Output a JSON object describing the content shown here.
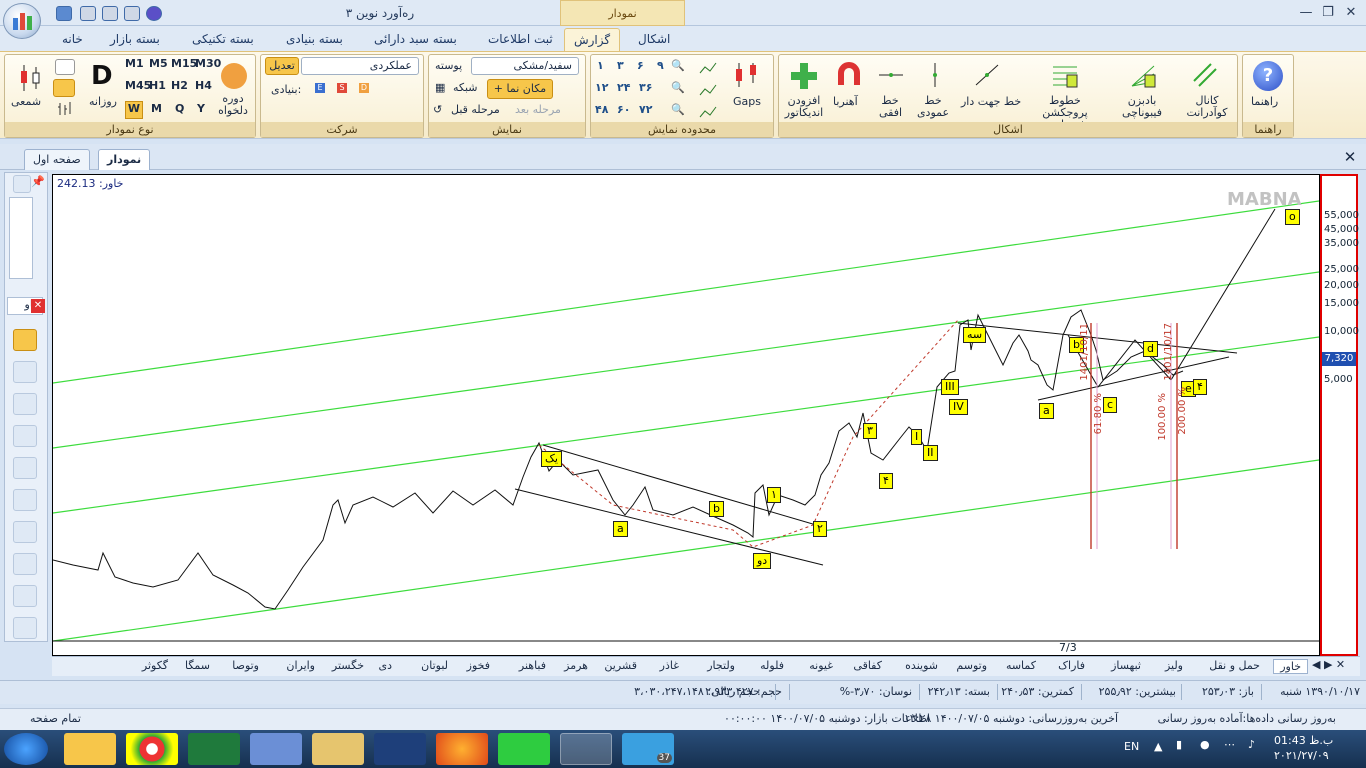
{
  "window": {
    "title": "ره‌آورد نوین ۳",
    "context_tab": "نمودار",
    "controls": [
      "—",
      "❐",
      "✕"
    ]
  },
  "ribbon_tabs": [
    "خانه",
    "بسته بازار",
    "بسته تکنیکی",
    "بسته بنیادی",
    "بسته سبد دارائی",
    "ثبت اطلاعات",
    "گزارش",
    "اشکال"
  ],
  "groups": {
    "chart_type": {
      "title": "نوع نمودار",
      "candle_label": "شمعی",
      "daily_label": "روزانه",
      "daily_letter": "D",
      "period_label": "دوره دلخواه",
      "timeframes": [
        "M1",
        "M5",
        "M15",
        "M30",
        "M45",
        "H1",
        "H2",
        "H4"
      ],
      "periods": [
        "W",
        "M",
        "Q",
        "Y"
      ]
    },
    "company": {
      "title": "شرکت",
      "adjust_button": "تعدیل",
      "adjust_mode": "عملکردی",
      "fundamental_label": "بنیادی:",
      "badges": [
        "E",
        "S",
        "D"
      ]
    },
    "display": {
      "title": "نمایش",
      "theme_label": "پوسته",
      "theme_value": "سفید/مشکی",
      "grid_label": "شبکه",
      "cursor_label": "مکان نما",
      "prev_step": "مرحله قبل",
      "next_step": "مرحله بعد"
    },
    "range": {
      "title": "محدوده نمایش",
      "ranges": [
        "۱",
        "۳",
        "۶",
        "۹",
        "۱۲",
        "۲۴",
        "۳۶",
        "۴۸",
        "۶۰",
        "۷۲"
      ],
      "gaps_label": "Gaps"
    },
    "shapes": {
      "title": "اشکال",
      "items": [
        "افزودن اندیکاتور",
        "آهنربا",
        "خط افقی",
        "خط عمودی",
        "خط جهت دار",
        "خطوط پروجکشن فیبوناچی",
        "بادبزن فیبوناچی",
        "کانال کوآدرانت"
      ]
    },
    "help": {
      "title": "راهنما",
      "label": "راهنما"
    }
  },
  "doc_tabs": [
    "صفحه اول",
    "نمودار"
  ],
  "left_tool_input": "خاو",
  "chart": {
    "header": "خاور: 242.13",
    "watermark": "MABNA",
    "date_label": "7/3",
    "price_box": "7,320",
    "y_ticks": [
      "55,000",
      "45,000",
      "35,000",
      "25,000",
      "20,000",
      "15,000",
      "10,000",
      "5,000"
    ],
    "wave_labels": [
      "یک",
      "دو",
      "سه",
      "a",
      "b",
      "c",
      "d",
      "e",
      "۱",
      "۲",
      "۳",
      "۴",
      "I",
      "II",
      "III",
      "IV",
      "a",
      "b",
      "۴",
      "o"
    ],
    "fib_labels": [
      "1401/10/11",
      "1401/10/17",
      "61.80 %",
      "100.00 %",
      "200.00 %"
    ]
  },
  "symbol_tabs": [
    "خاور",
    "حمل و نقل",
    "ولیز",
    "ثبهساز",
    "فاراک",
    "کماسه",
    "وتوسم",
    "شوینده",
    "کفاقی",
    "غیونه",
    "فلوله",
    "ولتجار",
    "غاذر",
    "قشرین",
    "هرمز",
    "فباهنر",
    "فخوز",
    "لبوتان",
    "دی",
    "خگستر",
    "وایران",
    "وتوصا",
    "سمگا",
    "گکوثر"
  ],
  "status": {
    "date": "۱۳۹۰/۱۰/۱۷ شنبه",
    "open": "باز: ۲۵۳٫۰۳",
    "high": "بیشترین: ۲۵۵٫۹۲",
    "low": "کمترین: ۲۴۰٫۵۳",
    "close": "بسته: ۲۴۲٫۱۳",
    "change": "نوسان: ۳٫۷۰-%",
    "volume": "حجم: ۲،۹۳۳،۴۲۷",
    "value": "حجم ریالی: ۳،۰۳۰،۲۴۷،۱۴۸",
    "sync_status": "به‌روز رسانی داده‌ها:آماده به‌روز رسانی",
    "last_update": "آخرین به‌روزرسانی: دوشنبه ۱۴۰۰/۰۷/۰۵ ۱۳:۲۸",
    "market_info": "اطلاعات بازار: دوشنبه ۱۴۰۰/۰۷/۰۵ ۰۰:۰۰:۰۰",
    "fullscreen": "تمام صفحه"
  },
  "taskbar": {
    "time": "01:43 ب.ظ",
    "date": "۲۰۲۱/۲۷/۰۹",
    "lang": "EN",
    "apps": [
      "windows-start",
      "kmplayer",
      "chrome",
      "excel",
      "media",
      "file-explorer",
      "stock-chart",
      "firefox",
      "whatsapp",
      "rahavard",
      "telegram"
    ],
    "telegram_badge": "37"
  },
  "colors": {
    "channel_green": "#3ddc3d",
    "label_yellow": "#ffff00",
    "price_border": "#e00000",
    "fib_red": "#c0392b"
  }
}
